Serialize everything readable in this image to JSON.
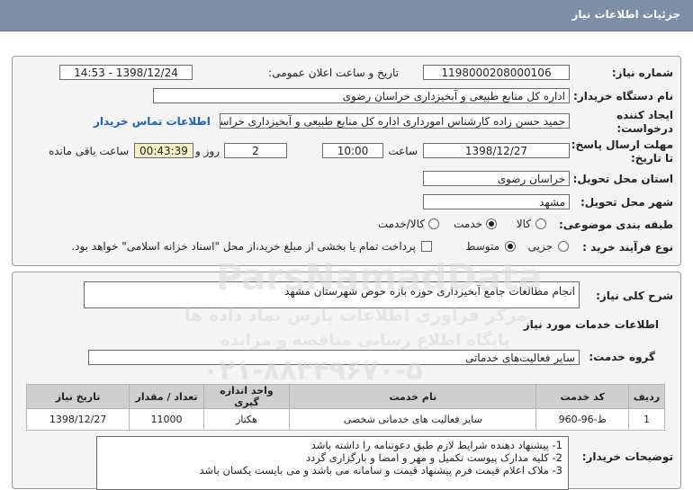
{
  "header": {
    "title": "جزئیات اطلاعات نیاز"
  },
  "form": {
    "need_number_label": "شماره نیاز:",
    "need_number": "1198000208000106",
    "announce_label": "تاریخ و ساعت اعلان عمومی:",
    "announce_value": "1398/12/24 - 14:53",
    "buyer_label": "نام دستگاه خریدار:",
    "buyer_value": "اداره کل منابع طبیعی و آبخیزداری خراسان رضوی",
    "requester_label_1": "ایجاد کننده",
    "requester_label_2": "درخواست:",
    "requester_value": "حمید حسن زاده  کارشناس امورداری اداره کل منابع طبیعی و آبخیزداری خراسان",
    "contact_link": "اطلاعات تماس خریدار",
    "deadline_label_1": "مهلت ارسال پاسخ:",
    "deadline_label_2": "تا تاریخ:",
    "deadline_date": "1398/12/27",
    "time_label": "ساعت",
    "deadline_time": "10:00",
    "days_value": "2",
    "days_label": "روز و",
    "remaining_value": "00:43:39",
    "remaining_label": "ساعت باقی مانده",
    "province_label": "استان محل تحویل:",
    "province_value": "خراسان رضوی",
    "city_label": "شهر محل تحویل:",
    "city_value": "مشهد",
    "category_label": "طبقه بندی موضوعی:",
    "category_options": [
      "کالا",
      "خدمت",
      "کالا/خدمت"
    ],
    "category_selected": "خدمت",
    "process_label": "نوع فرآیند خرید :",
    "process_options": [
      "جزیی",
      "متوسط"
    ],
    "process_selected": "متوسط",
    "payment_note": "پرداخت تمام یا بخشی از مبلغ خرید،از محل \"اسناد خزانه اسلامی\" خواهد بود."
  },
  "summary": {
    "label": "شرح کلی نیاز:",
    "value": "انجام مطالعات جامع آبخیزداری حوزه بازه حوض شهرستان مشهد"
  },
  "services": {
    "section_title": "اطلاعات خدمات مورد نیاز",
    "group_label": "گروه خدمت:",
    "group_value": "سایر فعالیت‌های خدماتی",
    "columns": [
      "ردیف",
      "کد خدمت",
      "نام خدمت",
      "واحد اندازه گیری",
      "تعداد / مقدار",
      "تاریخ نیاز"
    ],
    "rows": [
      [
        "1",
        "ط-96-960",
        "سایر فعالیت های خدماتی شخصی",
        "هکتار",
        "11000",
        "1398/12/27"
      ]
    ]
  },
  "notes": {
    "label": "توضیحات خریدار:",
    "lines": [
      "1- پیشنهاد دهنده شرایط لازم طبق دعوتنامه را داشته باشد",
      "2- کلیه مدارک پیوست تکمیل و مهر و امضا و بارگزاری گردد",
      "3- ملاک اعلام قیمت فرم پیشنهاد قیمت و سامانه می باشد و می بایست یکسان باشد"
    ]
  },
  "watermark": {
    "brand": "ParsNamadData",
    "line1": "مرکز فراوری اطلاعات پارس نماد داده ها",
    "line2": "پایگاه اطلاع رسانی مناقصه و مزایده",
    "phone": "۰۲۱-۸۸۳۴۹۶۷۰-۵"
  }
}
